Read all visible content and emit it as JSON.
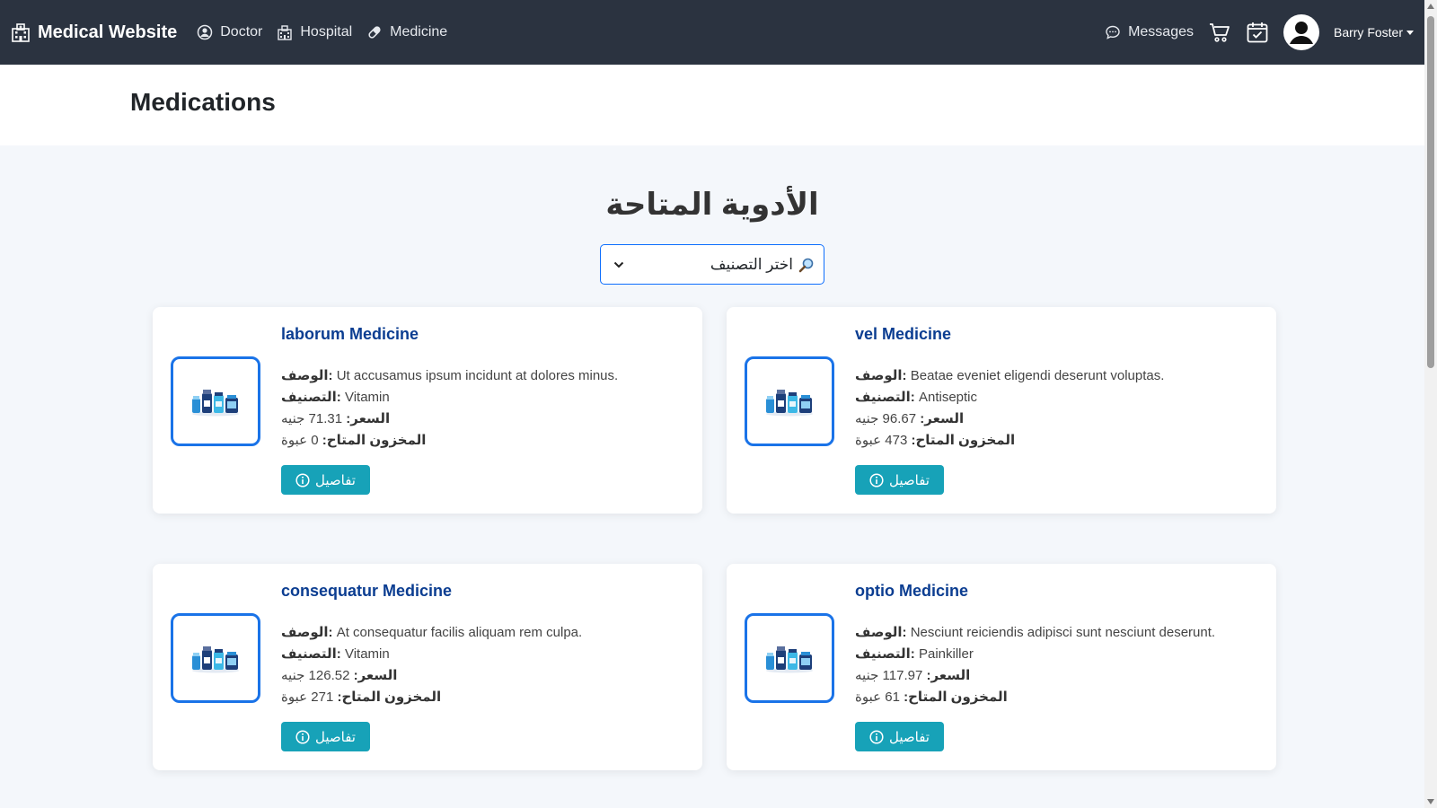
{
  "navbar": {
    "brand": "Medical Website",
    "links": [
      {
        "label": "Doctor",
        "icon": "user-circle-icon"
      },
      {
        "label": "Hospital",
        "icon": "hospital-icon"
      },
      {
        "label": "Medicine",
        "icon": "pill-icon"
      }
    ],
    "messages_label": "Messages",
    "user_name": "Barry Foster"
  },
  "header": {
    "title": "Medications"
  },
  "section": {
    "title": "الأدوية المتاحة",
    "filter": {
      "selected": "اختر التصنيف",
      "icon": "search-icon"
    }
  },
  "labels": {
    "description": "الوصف:",
    "category": "التصنيف:",
    "price": "السعر:",
    "stock": "المخزون المتاح:",
    "details_button": "تفاصيل"
  },
  "medicines": [
    {
      "name": "laborum Medicine",
      "description": "Ut accusamus ipsum incidunt at dolores minus.",
      "category": "Vitamin",
      "price": "71.31 جنيه",
      "stock": "0 عبوة"
    },
    {
      "name": "vel Medicine",
      "description": "Beatae eveniet eligendi deserunt voluptas.",
      "category": "Antiseptic",
      "price": "96.67 جنيه",
      "stock": "473 عبوة"
    },
    {
      "name": "consequatur Medicine",
      "description": "At consequatur facilis aliquam rem culpa.",
      "category": "Vitamin",
      "price": "126.52 جنيه",
      "stock": "271 عبوة"
    },
    {
      "name": "optio Medicine",
      "description": "Nesciunt reiciendis adipisci sunt nesciunt deserunt.",
      "category": "Painkiller",
      "price": "117.97 جنيه",
      "stock": "61 عبوة"
    }
  ],
  "colors": {
    "navbar_bg": "#2b3340",
    "accent_blue": "#1a73e8",
    "details_button": "#17a2b8",
    "medicine_name": "#0b3d91"
  }
}
